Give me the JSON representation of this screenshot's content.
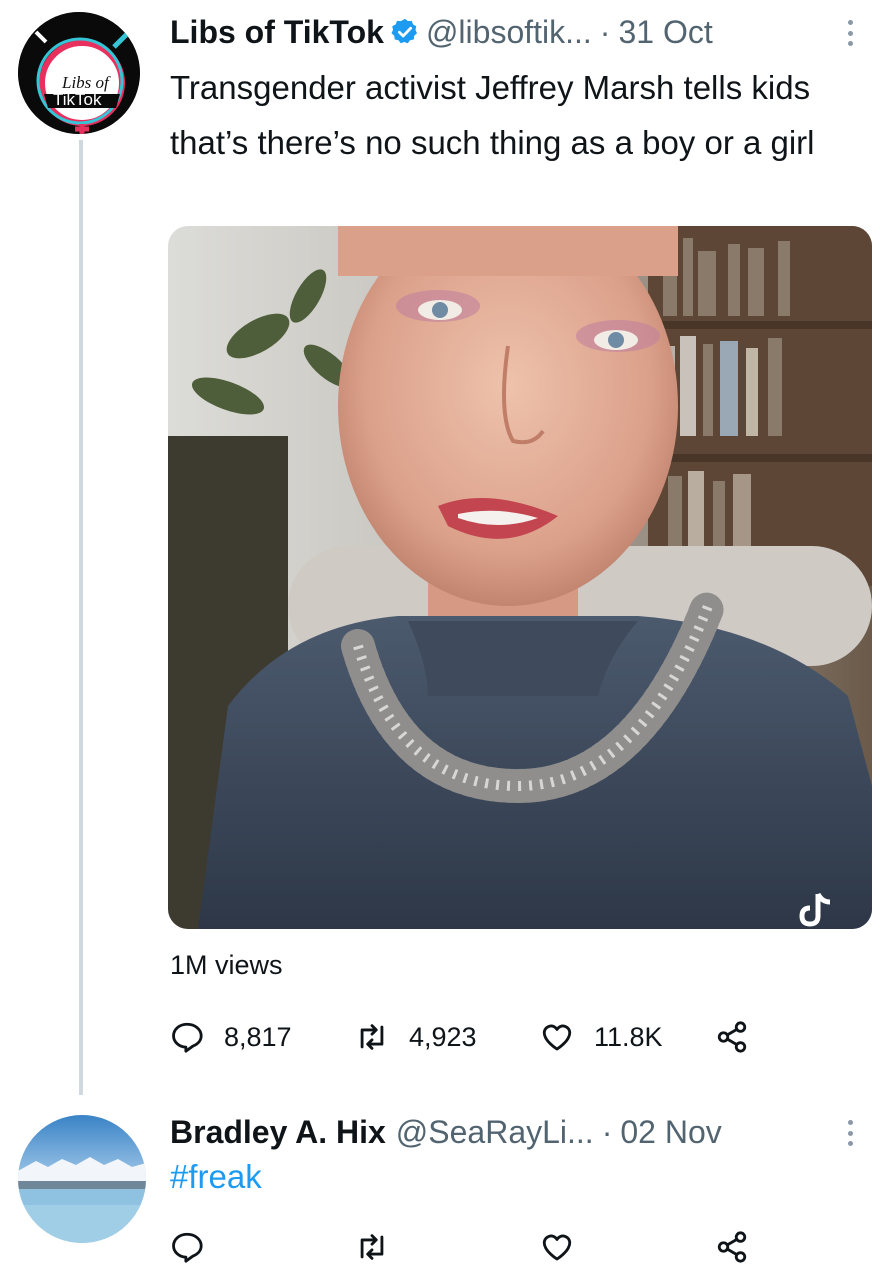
{
  "tweet": {
    "author_name": "Libs of TikTok",
    "handle": "@libsoftik...",
    "separator": "·",
    "date": "31 Oct",
    "text": "Transgender activist Jeffrey Marsh tells kids that’s there’s no such thing as a boy or a girl",
    "avatar_label_line1": "Libs of",
    "avatar_label_line2": "TikTok",
    "views": "1M views",
    "replies": "8,817",
    "retweets": "4,923",
    "likes": "11.8K"
  },
  "reply": {
    "author_name": "Bradley A. Hix",
    "handle": "@SeaRayLi...",
    "separator": "·",
    "date": "02 Nov",
    "text": "#freak"
  },
  "colors": {
    "verified": "#1d9bf0",
    "hashtag": "#1d9bf0",
    "secondary_text": "#536471",
    "thread_line": "#cfd9de"
  }
}
